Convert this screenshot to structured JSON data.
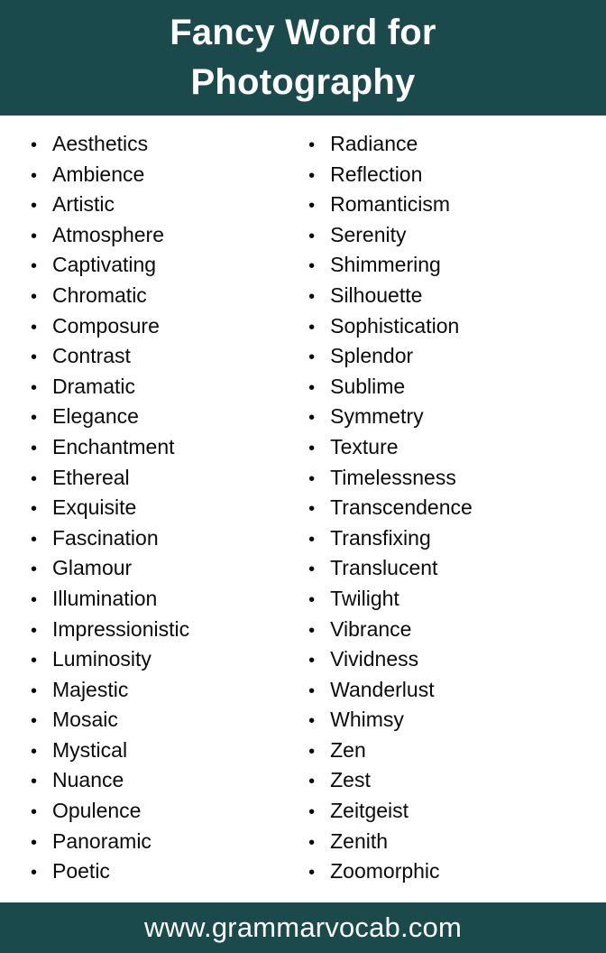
{
  "header": {
    "title": "Fancy Word for\nPhotography",
    "background_color": "#1b4a4c",
    "text_color": "#ffffff"
  },
  "footer": {
    "url": "www.grammarvocab.com",
    "background_color": "#1b4a4c",
    "text_color": "#ffffff"
  },
  "bullet_glyph": "•",
  "columns": {
    "left": [
      {
        "word": "Aesthetics"
      },
      {
        "word": "Ambience"
      },
      {
        "word": "Artistic"
      },
      {
        "word": "Atmosphere"
      },
      {
        "word": "Captivating"
      },
      {
        "word": "Chromatic"
      },
      {
        "word": "Composure"
      },
      {
        "word": "Contrast"
      },
      {
        "word": "Dramatic"
      },
      {
        "word": "Elegance"
      },
      {
        "word": "Enchantment"
      },
      {
        "word": "Ethereal"
      },
      {
        "word": "Exquisite"
      },
      {
        "word": "Fascination"
      },
      {
        "word": "Glamour"
      },
      {
        "word": "Illumination"
      },
      {
        "word": "Impressionistic"
      },
      {
        "word": "Luminosity"
      },
      {
        "word": "Majestic"
      },
      {
        "word": "Mosaic"
      },
      {
        "word": "Mystical"
      },
      {
        "word": "Nuance"
      },
      {
        "word": "Opulence"
      },
      {
        "word": "Panoramic"
      },
      {
        "word": "Poetic"
      }
    ],
    "right": [
      {
        "word": "Radiance"
      },
      {
        "word": "Reflection"
      },
      {
        "word": "Romanticism"
      },
      {
        "word": "Serenity"
      },
      {
        "word": "Shimmering"
      },
      {
        "word": "Silhouette"
      },
      {
        "word": "Sophistication"
      },
      {
        "word": "Splendor"
      },
      {
        "word": "Sublime"
      },
      {
        "word": "Symmetry"
      },
      {
        "word": "Texture"
      },
      {
        "word": "Timelessness"
      },
      {
        "word": "Transcendence"
      },
      {
        "word": "Transfixing"
      },
      {
        "word": "Translucent"
      },
      {
        "word": "Twilight"
      },
      {
        "word": "Vibrance"
      },
      {
        "word": "Vividness"
      },
      {
        "word": "Wanderlust"
      },
      {
        "word": "Whimsy"
      },
      {
        "word": "Zen"
      },
      {
        "word": "Zest"
      },
      {
        "word": "Zeitgeist"
      },
      {
        "word": "Zenith"
      },
      {
        "word": "Zoomorphic"
      }
    ]
  }
}
